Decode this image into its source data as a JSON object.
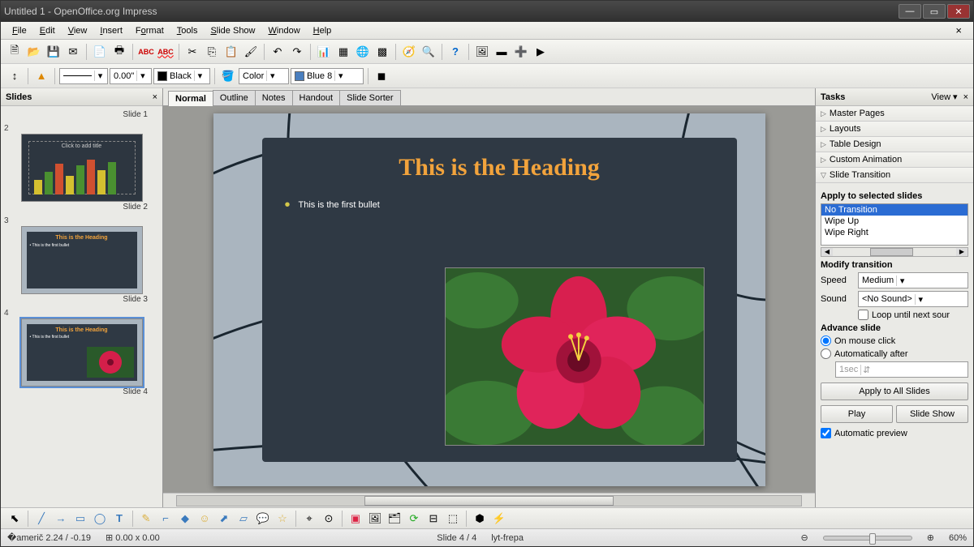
{
  "window": {
    "title": "Untitled 1 - OpenOffice.org Impress"
  },
  "menu": {
    "file": "File",
    "edit": "Edit",
    "view": "View",
    "insert": "Insert",
    "format": "Format",
    "tools": "Tools",
    "slideshow": "Slide Show",
    "window": "Window",
    "help": "Help"
  },
  "toolbar2": {
    "line_width": "0.00\"",
    "color_name": "Black",
    "fill_mode": "Color",
    "fill_name": "Blue 8",
    "color_hex": "#000000",
    "fill_hex": "#4a7fbf"
  },
  "slides_panel": {
    "title": "Slides",
    "items": [
      {
        "num": "1",
        "label": "Slide 1",
        "heading": "",
        "bullet": "Click to add title",
        "kind": "chart"
      },
      {
        "num": "2",
        "label": "Slide 2",
        "heading": "",
        "bullet": "",
        "kind": "blank"
      },
      {
        "num": "3",
        "label": "Slide 3",
        "heading": "This is the Heading",
        "bullet": "• This is the first bullet",
        "kind": "text"
      },
      {
        "num": "4",
        "label": "Slide 4",
        "heading": "This is the Heading",
        "bullet": "• This is the first bullet",
        "kind": "flower"
      }
    ]
  },
  "viewtabs": {
    "normal": "Normal",
    "outline": "Outline",
    "notes": "Notes",
    "handout": "Handout",
    "sorter": "Slide Sorter"
  },
  "slide": {
    "heading": "This is the Heading",
    "bullet": "This is the first bullet"
  },
  "tasks": {
    "title": "Tasks",
    "view_label": "View",
    "sections": {
      "master": "Master Pages",
      "layouts": "Layouts",
      "table": "Table Design",
      "anim": "Custom Animation",
      "transition": "Slide Transition"
    },
    "apply_label": "Apply to selected slides",
    "transitions": [
      "No Transition",
      "Wipe Up",
      "Wipe Right"
    ],
    "modify_label": "Modify transition",
    "speed_label": "Speed",
    "speed_value": "Medium",
    "sound_label": "Sound",
    "sound_value": "<No Sound>",
    "loop_label": "Loop until next sour",
    "advance_label": "Advance slide",
    "on_click": "On mouse click",
    "auto_after": "Automatically after",
    "auto_value": "1sec",
    "apply_all": "Apply to All Slides",
    "play": "Play",
    "slideshow": "Slide Show",
    "auto_preview": "Automatic preview"
  },
  "status": {
    "coords": "2.24 / -0.19",
    "size": "0.00 x 0.00",
    "slide": "Slide 4 / 4",
    "template": "lyt-frepa",
    "zoom": "60%"
  }
}
